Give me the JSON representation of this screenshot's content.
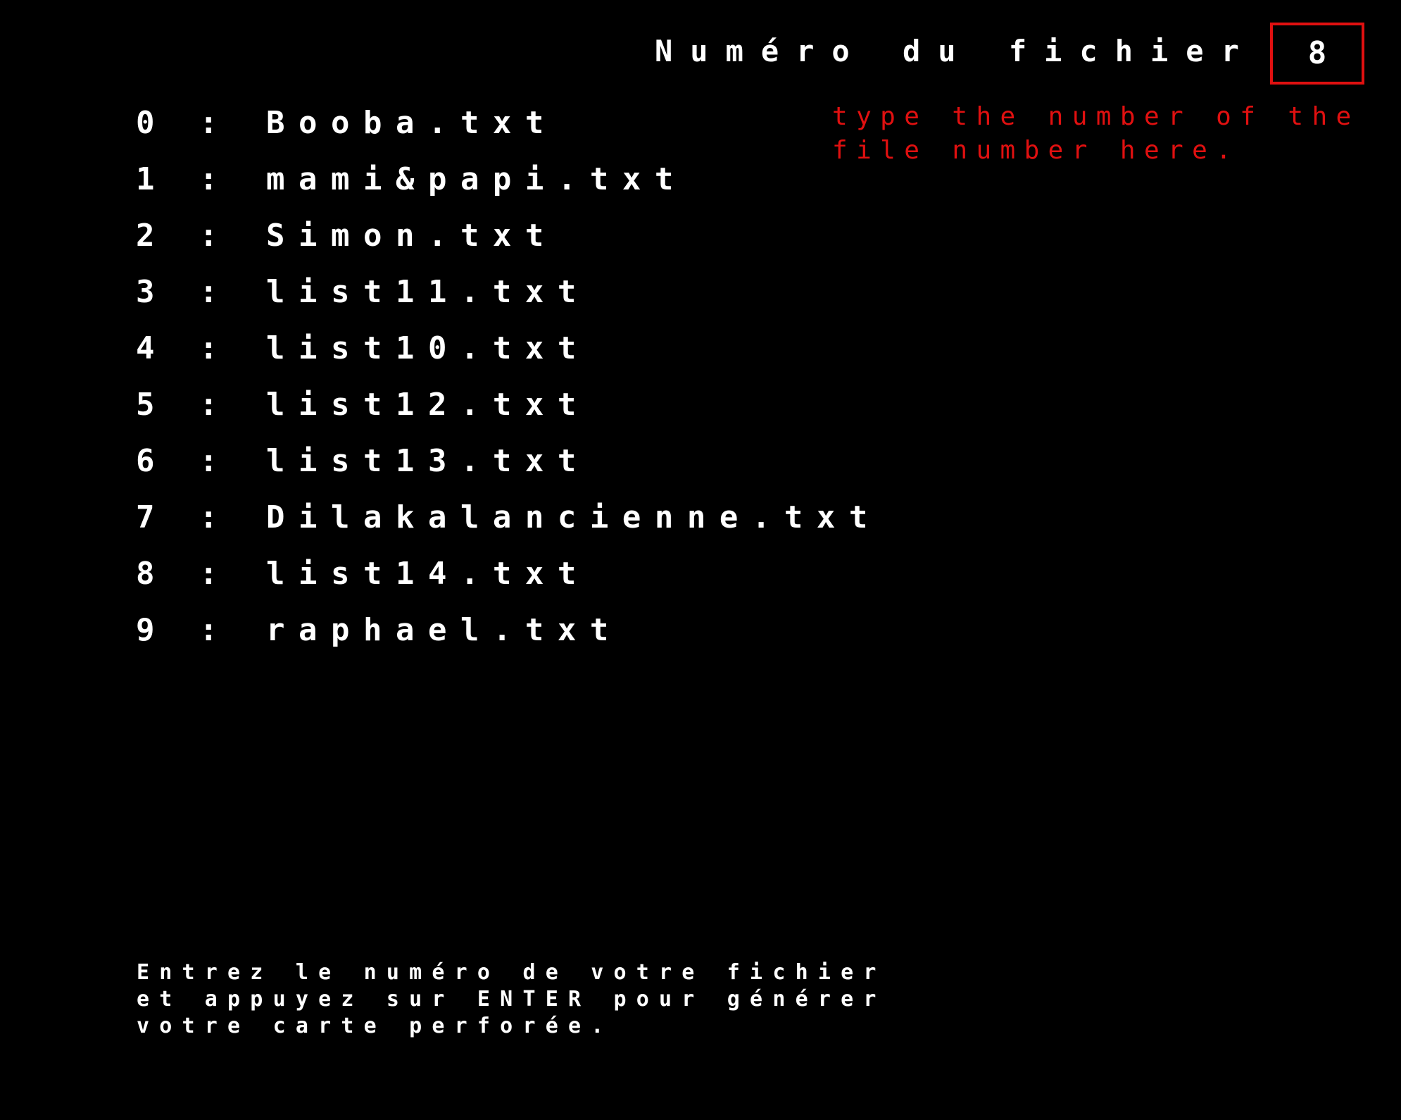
{
  "prompt": {
    "label": "Numéro du fichier :",
    "value": "8",
    "hint": "type the number of the file number here."
  },
  "files": [
    {
      "index": "0",
      "separator": ":",
      "name": "Booba.txt"
    },
    {
      "index": "1",
      "separator": ":",
      "name": "mami&papi.txt"
    },
    {
      "index": "2",
      "separator": ":",
      "name": "Simon.txt"
    },
    {
      "index": "3",
      "separator": ":",
      "name": "list11.txt"
    },
    {
      "index": "4",
      "separator": ":",
      "name": "list10.txt"
    },
    {
      "index": "5",
      "separator": ":",
      "name": "list12.txt"
    },
    {
      "index": "6",
      "separator": ":",
      "name": "list13.txt"
    },
    {
      "index": "7",
      "separator": ":",
      "name": "Dilakalancienne.txt"
    },
    {
      "index": "8",
      "separator": ":",
      "name": "list14.txt"
    },
    {
      "index": "9",
      "separator": ":",
      "name": "raphael.txt"
    }
  ],
  "instructions": {
    "lines": [
      "Entrez le numéro de votre fichier",
      "et appuyez sur ENTER pour générer",
      "votre carte perforée."
    ]
  },
  "colors": {
    "background": "#000000",
    "text": "#ffffff",
    "accent": "#e01010"
  }
}
